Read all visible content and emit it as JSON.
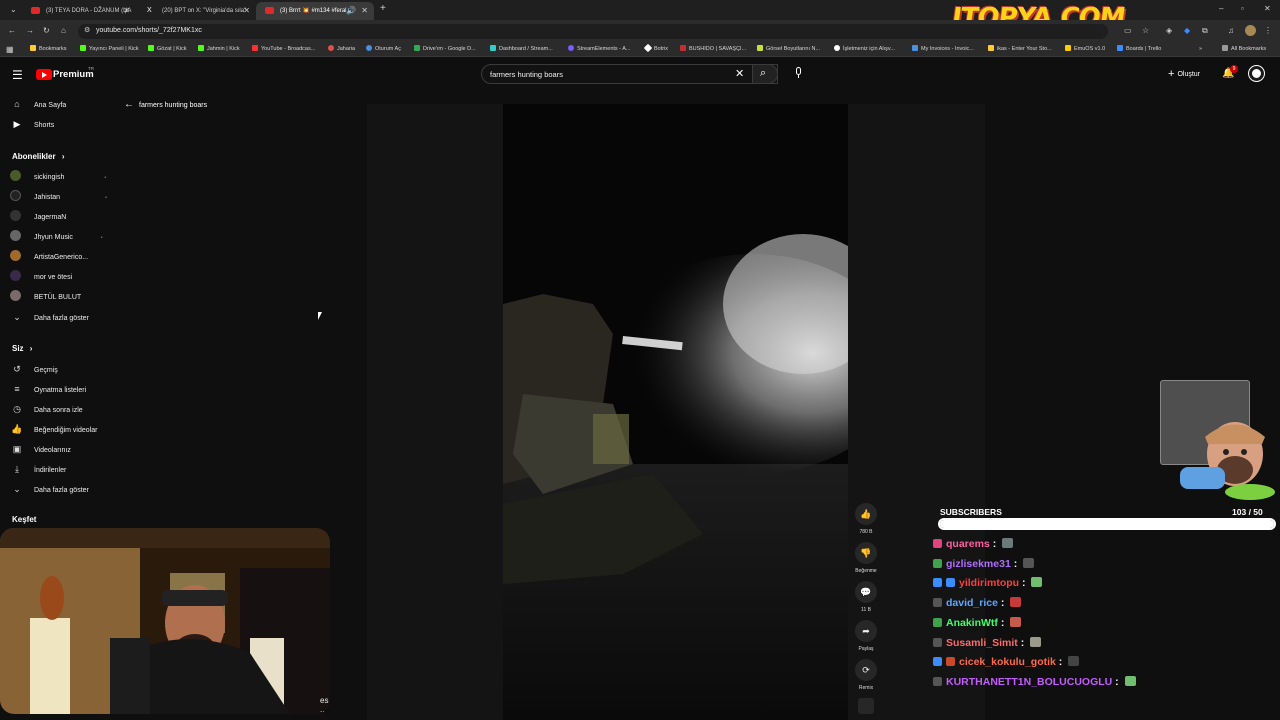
{
  "browser": {
    "tabs": [
      {
        "label": "(3) TEYA DORA - DŽANUM (ЏА",
        "active": false
      },
      {
        "label": "(20) BPT on X: \"Virginia'da sıla\"",
        "active": false
      },
      {
        "label": "(3) Brrrt 💥 #m134 #feral",
        "active": true
      }
    ],
    "url": "youtube.com/shorts/_72f27MK1xc",
    "bookmarks": [
      "Bookmarks",
      "Yayıncı Paneli | Kick",
      "Gözat | Kick",
      "Jahmin | Kick",
      "YouTube - Broadcas...",
      "Jaharia",
      "Oturum Aç",
      "Drive'ım - Google D...",
      "Dashboard / Stream...",
      "StreamElements - A...",
      "Botrix",
      "BUSHIDO | SAVAŞÇI...",
      "Görsel Boyutlarını N...",
      "İşletmeniz için Alışv...",
      "My Invoices - Invoic...",
      "ikas - Enter Your Sto...",
      "EmuOS v1.0",
      "Boards | Trello"
    ],
    "all_bookmarks": "All Bookmarks"
  },
  "overlay_logo": "ITOPYA.COM",
  "header": {
    "logo": "Premium",
    "logo_sup": "TR",
    "search_value": "farmers hunting boars",
    "create_label": "Oluştur",
    "notif_count": "9"
  },
  "back_label": "farmers hunting boars",
  "sidebar": {
    "top": [
      {
        "label": "Ana Sayfa",
        "icon": "home-icon",
        "glyph": "⌂"
      },
      {
        "label": "Shorts",
        "icon": "shorts-icon",
        "glyph": "▶"
      }
    ],
    "subs_title": "Abonelikler",
    "subs": [
      {
        "label": "sickingish",
        "color": "#4a5a2a"
      },
      {
        "label": "Jahistan",
        "color": "#222"
      },
      {
        "label": "JagermaN",
        "color": "#333"
      },
      {
        "label": "Jhyun Music",
        "color": "#666"
      },
      {
        "label": "ArtistaGenerico...",
        "color": "#a26a2a"
      },
      {
        "label": "mor ve ötesi",
        "color": "#3a2a4a"
      },
      {
        "label": "BETÜL BULUT",
        "color": "#7a6a6a"
      },
      {
        "label": "Daha fazla göster",
        "color": ""
      }
    ],
    "you_title": "Siz",
    "you": [
      {
        "label": "Geçmiş",
        "icon": "history-icon",
        "glyph": "↺"
      },
      {
        "label": "Oynatma listeleri",
        "icon": "playlists-icon",
        "glyph": "≡"
      },
      {
        "label": "Daha sonra izle",
        "icon": "watch-later-icon",
        "glyph": "◷"
      },
      {
        "label": "Beğendiğim videolar",
        "icon": "liked-icon",
        "glyph": "👍"
      },
      {
        "label": "Videolarınız",
        "icon": "your-videos-icon",
        "glyph": "▣"
      },
      {
        "label": "İndirilenler",
        "icon": "downloads-icon",
        "glyph": "⤓"
      },
      {
        "label": "Daha fazla göster",
        "icon": "chevron-down-icon",
        "glyph": "⌄"
      }
    ],
    "explore_title": "Keşfet"
  },
  "actions": [
    {
      "name": "like",
      "glyph": "👍",
      "label": "780 B"
    },
    {
      "name": "dislike",
      "glyph": "👎",
      "label": "Beğenme"
    },
    {
      "name": "comments",
      "glyph": "💬",
      "label": "11 B"
    },
    {
      "name": "share",
      "glyph": "➦",
      "label": "Paylaş"
    },
    {
      "name": "remix",
      "glyph": "⟳",
      "label": "Remix"
    }
  ],
  "webcam_caption": "es ...",
  "subscribers": {
    "title": "SUBSCRIBERS",
    "count": "103",
    "goal": "/ 50",
    "progress": 1.0
  },
  "chat": [
    {
      "user": "quarems",
      "color": "#ff5fa2",
      "badge": "#e0447c"
    },
    {
      "user": "gizlisekme31",
      "color": "#b06cff",
      "badge": "#3fa34d"
    },
    {
      "user": "yildirimtopu",
      "color": "#ff3d3d",
      "badge": "#3b8cff"
    },
    {
      "user": "david_rice",
      "color": "#5fa8ff",
      "badge": "#555"
    },
    {
      "user": "AnakinWtf",
      "color": "#3fff6a",
      "badge": "#3fa34d"
    },
    {
      "user": "Susamli_Simit",
      "color": "#ff6a6a",
      "badge": "#555"
    },
    {
      "user": "cicek_kokulu_gotik",
      "color": "#ff6a4a",
      "badge": "#3b8cff"
    },
    {
      "user": "KURTHANETT1N_BOLUCUOGLU",
      "color": "#c45cff",
      "badge": "#555"
    }
  ]
}
